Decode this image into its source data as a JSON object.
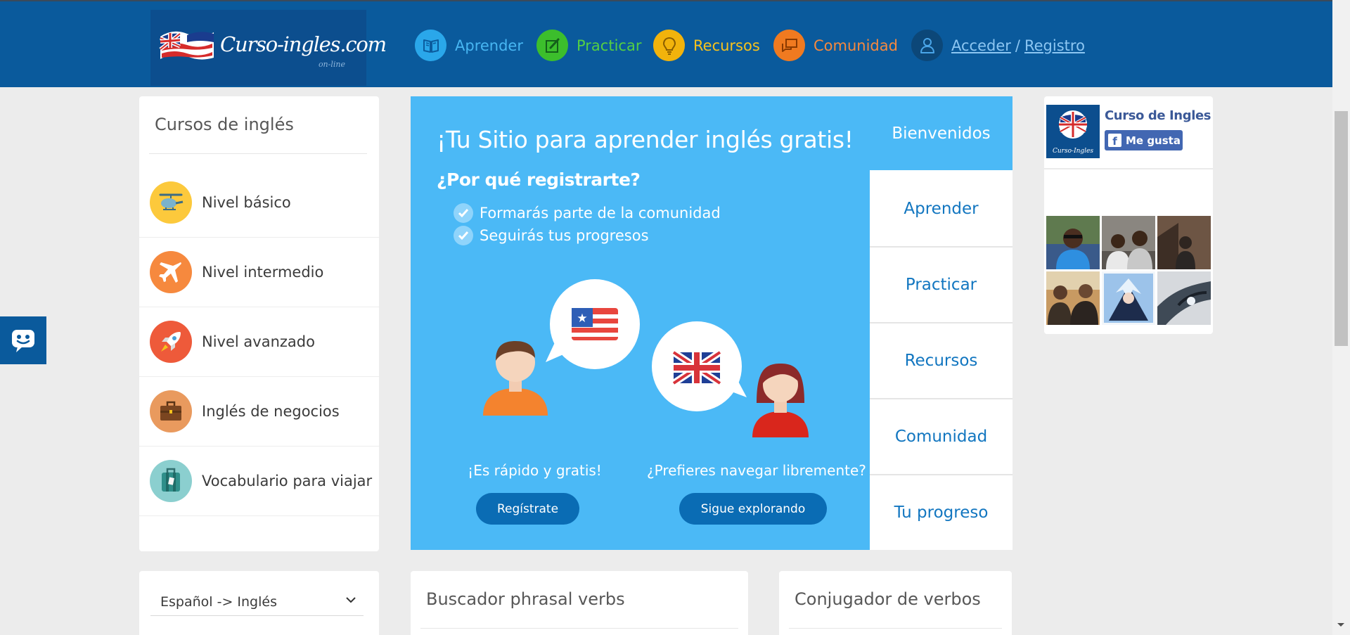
{
  "header": {
    "logo": {
      "text": "Curso-ingles.com",
      "sub": "on-line"
    },
    "nav": [
      {
        "label": "Aprender",
        "icon": "book-icon",
        "color": "#2aa7ea"
      },
      {
        "label": "Practicar",
        "icon": "edit-icon",
        "color": "#3cbe2c"
      },
      {
        "label": "Recursos",
        "icon": "lightbulb-icon",
        "color": "#f2b30c"
      },
      {
        "label": "Comunidad",
        "icon": "chat-bubbles-icon",
        "color": "#f07a20"
      }
    ],
    "account": {
      "login": "Acceder",
      "separator": "/",
      "register": "Registro"
    }
  },
  "courses": {
    "title": "Cursos de inglés",
    "items": [
      {
        "label": "Nivel básico",
        "icon": "helicopter-icon",
        "color": "#fcc93c"
      },
      {
        "label": "Nivel intermedio",
        "icon": "airplane-icon",
        "color": "#f6893e"
      },
      {
        "label": "Nivel avanzado",
        "icon": "rocket-icon",
        "color": "#ee5a3a"
      },
      {
        "label": "Inglés de negocios",
        "icon": "briefcase-icon",
        "color": "#e99a5e"
      },
      {
        "label": "Vocabulario para viajar",
        "icon": "suitcase-icon",
        "color": "#8bcfcf"
      }
    ]
  },
  "hero": {
    "title": "¡Tu Sitio para aprender inglés gratis!",
    "subtitle": "¿Por qué registrarte?",
    "benefits": [
      "Formarás parte de la comunidad",
      "Seguirás tus progresos"
    ],
    "left_caption": "¡Es rápido y gratis!",
    "left_button": "Regístrate",
    "right_caption": "¿Prefieres navegar libremente?",
    "right_button": "Sigue explorando",
    "background": "#4bb9f6"
  },
  "tabs": [
    "Bienvenidos",
    "Aprender",
    "Practicar",
    "Recursos",
    "Comunidad",
    "Tu progreso"
  ],
  "facebook": {
    "page_name": "Curso de Ingles",
    "logo_text": "Curso-Ingles",
    "like_label": "Me gusta"
  },
  "bottom": {
    "language_select": "Español -> Inglés",
    "phrasal_title": "Buscador phrasal verbs",
    "conjugator_title": "Conjugador de verbos"
  },
  "colors": {
    "header": "#0a5a9c",
    "accent": "#1276c0",
    "page_bg": "#ececec"
  }
}
